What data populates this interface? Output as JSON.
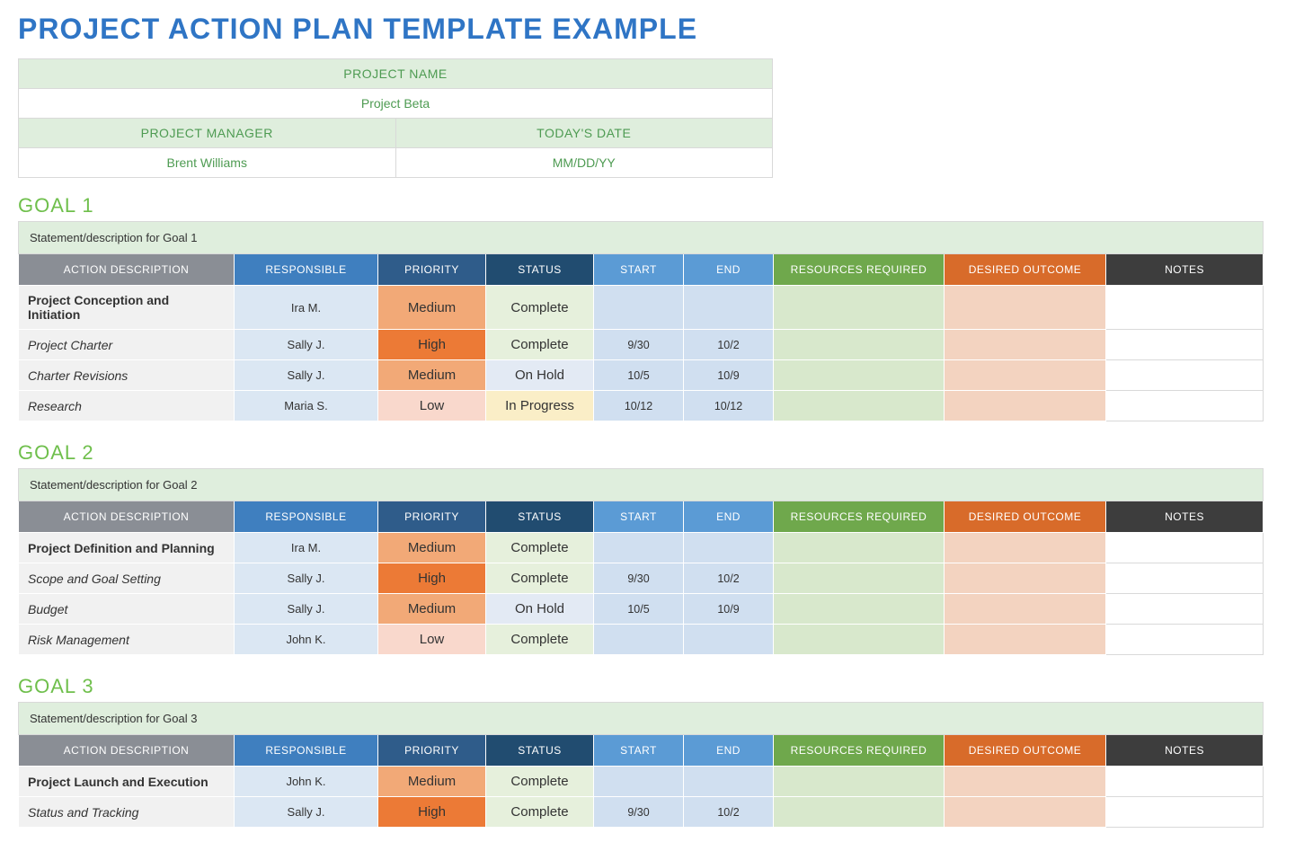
{
  "page_title": "PROJECT ACTION PLAN TEMPLATE EXAMPLE",
  "info": {
    "project_name_label": "PROJECT NAME",
    "project_name": "Project Beta",
    "project_manager_label": "PROJECT MANAGER",
    "project_manager": "Brent Williams",
    "date_label": "TODAY'S DATE",
    "date_value": "MM/DD/YY"
  },
  "columns": {
    "action": "ACTION DESCRIPTION",
    "responsible": "RESPONSIBLE",
    "priority": "PRIORITY",
    "status": "STATUS",
    "start": "START",
    "end": "END",
    "resources": "RESOURCES REQUIRED",
    "outcome": "DESIRED OUTCOME",
    "notes": "NOTES"
  },
  "goals": [
    {
      "title": "GOAL 1",
      "statement": "Statement/description for Goal 1",
      "rows": [
        {
          "action": "Project Conception and Initiation",
          "bold": true,
          "responsible": "Ira M.",
          "priority": "Medium",
          "status": "Complete",
          "start": "",
          "end": "",
          "resources": "",
          "outcome": "",
          "notes": ""
        },
        {
          "action": "Project Charter",
          "bold": false,
          "responsible": "Sally J.",
          "priority": "High",
          "status": "Complete",
          "start": "9/30",
          "end": "10/2",
          "resources": "",
          "outcome": "",
          "notes": ""
        },
        {
          "action": "Charter Revisions",
          "bold": false,
          "responsible": "Sally J.",
          "priority": "Medium",
          "status": "On Hold",
          "start": "10/5",
          "end": "10/9",
          "resources": "",
          "outcome": "",
          "notes": ""
        },
        {
          "action": "Research",
          "bold": false,
          "responsible": "Maria S.",
          "priority": "Low",
          "status": "In Progress",
          "start": "10/12",
          "end": "10/12",
          "resources": "",
          "outcome": "",
          "notes": ""
        }
      ]
    },
    {
      "title": "GOAL 2",
      "statement": "Statement/description for Goal 2",
      "rows": [
        {
          "action": "Project Definition and Planning",
          "bold": true,
          "responsible": "Ira M.",
          "priority": "Medium",
          "status": "Complete",
          "start": "",
          "end": "",
          "resources": "",
          "outcome": "",
          "notes": ""
        },
        {
          "action": "Scope and Goal Setting",
          "bold": false,
          "responsible": "Sally J.",
          "priority": "High",
          "status": "Complete",
          "start": "9/30",
          "end": "10/2",
          "resources": "",
          "outcome": "",
          "notes": ""
        },
        {
          "action": "Budget",
          "bold": false,
          "responsible": "Sally J.",
          "priority": "Medium",
          "status": "On Hold",
          "start": "10/5",
          "end": "10/9",
          "resources": "",
          "outcome": "",
          "notes": ""
        },
        {
          "action": "Risk Management",
          "bold": false,
          "responsible": "John K.",
          "priority": "Low",
          "status": "Complete",
          "start": "",
          "end": "",
          "resources": "",
          "outcome": "",
          "notes": ""
        }
      ]
    },
    {
      "title": "GOAL 3",
      "statement": "Statement/description for Goal 3",
      "rows": [
        {
          "action": "Project Launch and Execution",
          "bold": true,
          "responsible": "John K.",
          "priority": "Medium",
          "status": "Complete",
          "start": "",
          "end": "",
          "resources": "",
          "outcome": "",
          "notes": ""
        },
        {
          "action": "Status and Tracking",
          "bold": false,
          "responsible": "Sally J.",
          "priority": "High",
          "status": "Complete",
          "start": "9/30",
          "end": "10/2",
          "resources": "",
          "outcome": "",
          "notes": ""
        }
      ]
    }
  ]
}
